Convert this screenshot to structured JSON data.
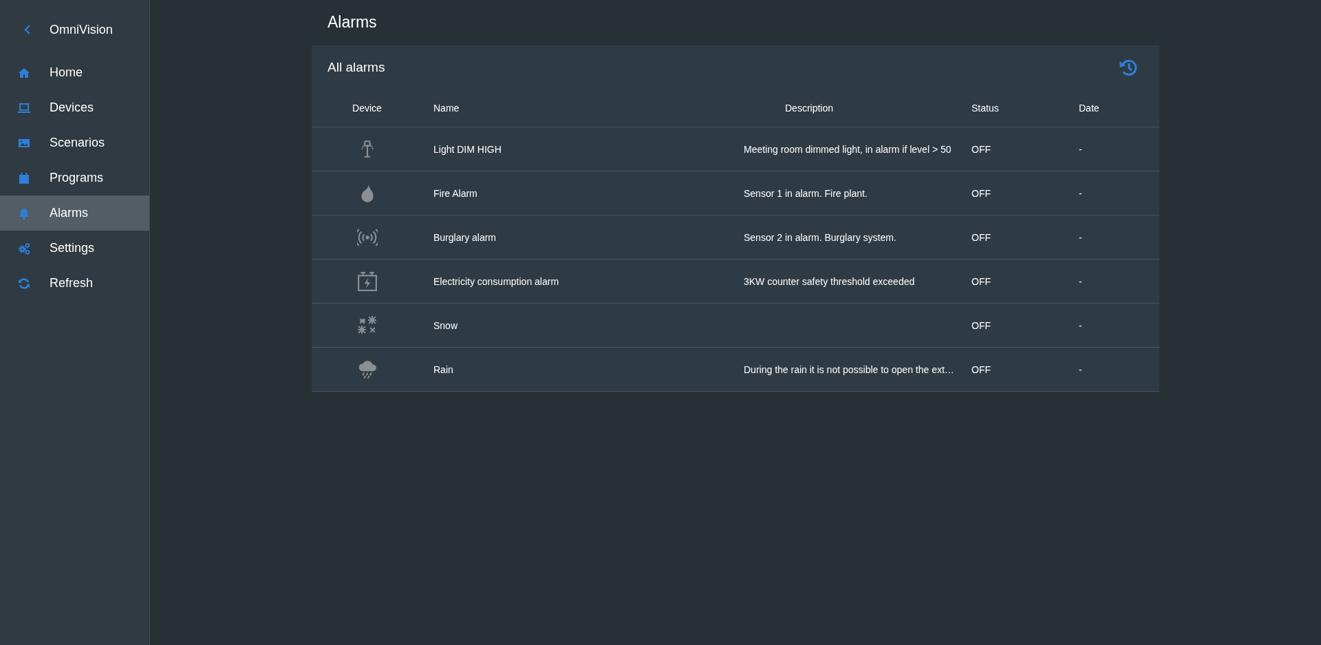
{
  "sidebar": {
    "title": "OmniVision",
    "items": [
      {
        "label": "Home",
        "kind": "home",
        "selected": false
      },
      {
        "label": "Devices",
        "kind": "devices",
        "selected": false
      },
      {
        "label": "Scenarios",
        "kind": "scenarios",
        "selected": false
      },
      {
        "label": "Programs",
        "kind": "programs",
        "selected": false
      },
      {
        "label": "Alarms",
        "kind": "alarms",
        "selected": true
      },
      {
        "label": "Settings",
        "kind": "settings",
        "selected": false
      },
      {
        "label": "Refresh",
        "kind": "refresh",
        "selected": false
      }
    ]
  },
  "page_title": "Alarms",
  "card": {
    "title": "All alarms",
    "table": {
      "columns": [
        "Device",
        "Name",
        "Description",
        "Status",
        "Date"
      ],
      "rows": [
        {
          "kind": "light",
          "name": "Light DIM HIGH",
          "description": "Meeting room dimmed light, in alarm if level > 50",
          "status": "OFF",
          "date": "-"
        },
        {
          "kind": "fire",
          "name": "Fire Alarm",
          "description": "Sensor 1 in alarm. Fire plant.",
          "status": "OFF",
          "date": "-"
        },
        {
          "kind": "sensor",
          "name": "Burglary alarm",
          "description": "Sensor 2 in alarm. Burglary system.",
          "status": "OFF",
          "date": "-"
        },
        {
          "kind": "electricity",
          "name": "Electricity consumption alarm",
          "description": "3KW counter safety threshold exceeded",
          "status": "OFF",
          "date": "-"
        },
        {
          "kind": "snow",
          "name": "Snow",
          "status": "OFF",
          "date": "-"
        },
        {
          "kind": "rain",
          "name": "Rain",
          "description": "During the rain it is not possible to open the ext…",
          "status": "OFF",
          "date": "-"
        }
      ]
    }
  }
}
